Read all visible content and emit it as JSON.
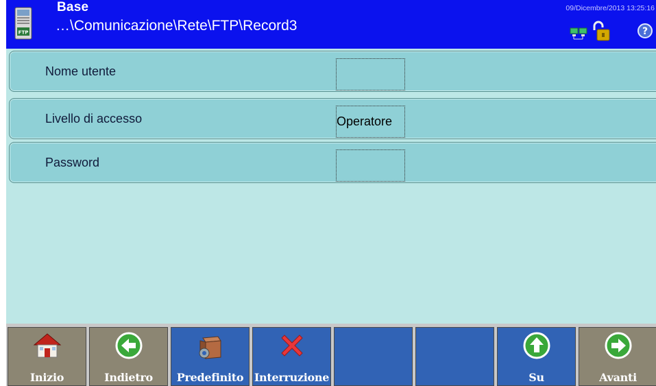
{
  "header": {
    "title": "Base",
    "path": "…\\Comunicazione\\Rete\\FTP\\Record3",
    "datetime": "09/Dicembre/2013 13:25:16",
    "icons": [
      "ftp-icon",
      "network-status-icon",
      "lock-open-icon",
      "help-icon"
    ]
  },
  "rows": [
    {
      "label": "Nome utente",
      "value": ""
    },
    {
      "label": "Livello di accesso",
      "value": "Operatore"
    },
    {
      "label": "Password",
      "value": ""
    }
  ],
  "toolbar": {
    "buttons": [
      {
        "label": "Inizio",
        "icon": "home-icon"
      },
      {
        "label": "Indietro",
        "icon": "arrow-left-icon"
      },
      {
        "label": "Predefinito",
        "icon": "default-box-gear-icon"
      },
      {
        "label": "Interruzione",
        "icon": "cancel-x-icon"
      },
      {
        "label": "",
        "icon": ""
      },
      {
        "label": "",
        "icon": ""
      },
      {
        "label": "Su",
        "icon": "arrow-up-icon"
      },
      {
        "label": "Avanti",
        "icon": "arrow-right-icon"
      }
    ]
  },
  "colors": {
    "header_bg": "#0b12ee",
    "content_bg": "#bde7e6",
    "row_bg": "#8fd0d6",
    "button_tan": "#8c8673",
    "button_blue": "#3163b5"
  }
}
